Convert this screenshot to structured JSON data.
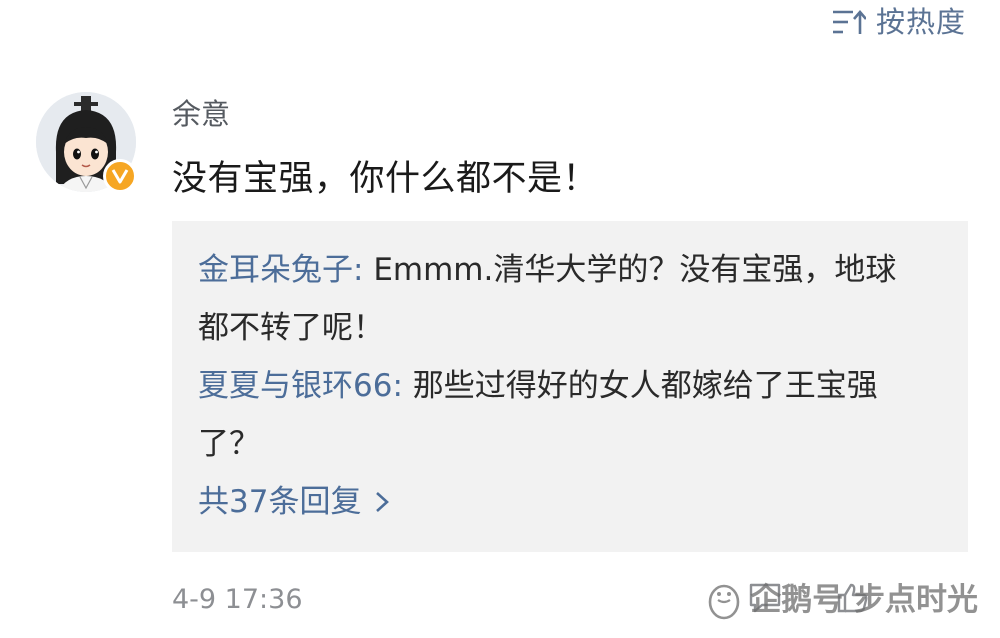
{
  "sort": {
    "icon": "sort-lines-icon",
    "label": "按热度"
  },
  "comment": {
    "avatar": "avatar",
    "verified_badge": "verified-v-badge",
    "username": "余意",
    "text": "没有宝强，你什么都不是！",
    "replies": [
      {
        "author": "金耳朵兔子",
        "separator": ": ",
        "text": "Emmm.清华大学的？没有宝强，地球都不转了呢！"
      },
      {
        "author": "夏夏与银环66",
        "separator": ": ",
        "text": "那些过得好的女人都嫁给了王宝强了？"
      }
    ],
    "more_replies_label": "共37条回复",
    "more_replies_icon": "chevron-right-icon",
    "timestamp": "4-9 17:36",
    "actions": [
      "comment-icon",
      "like-icon"
    ]
  },
  "watermark": {
    "icon": "penguin-icon",
    "text": "企鹅号 步点时光"
  },
  "colors": {
    "link": "#4c6d99",
    "sort": "#5b7394",
    "reply_bg": "#f2f2f2",
    "badge": "#f6a623",
    "meta": "#8d8f93"
  }
}
